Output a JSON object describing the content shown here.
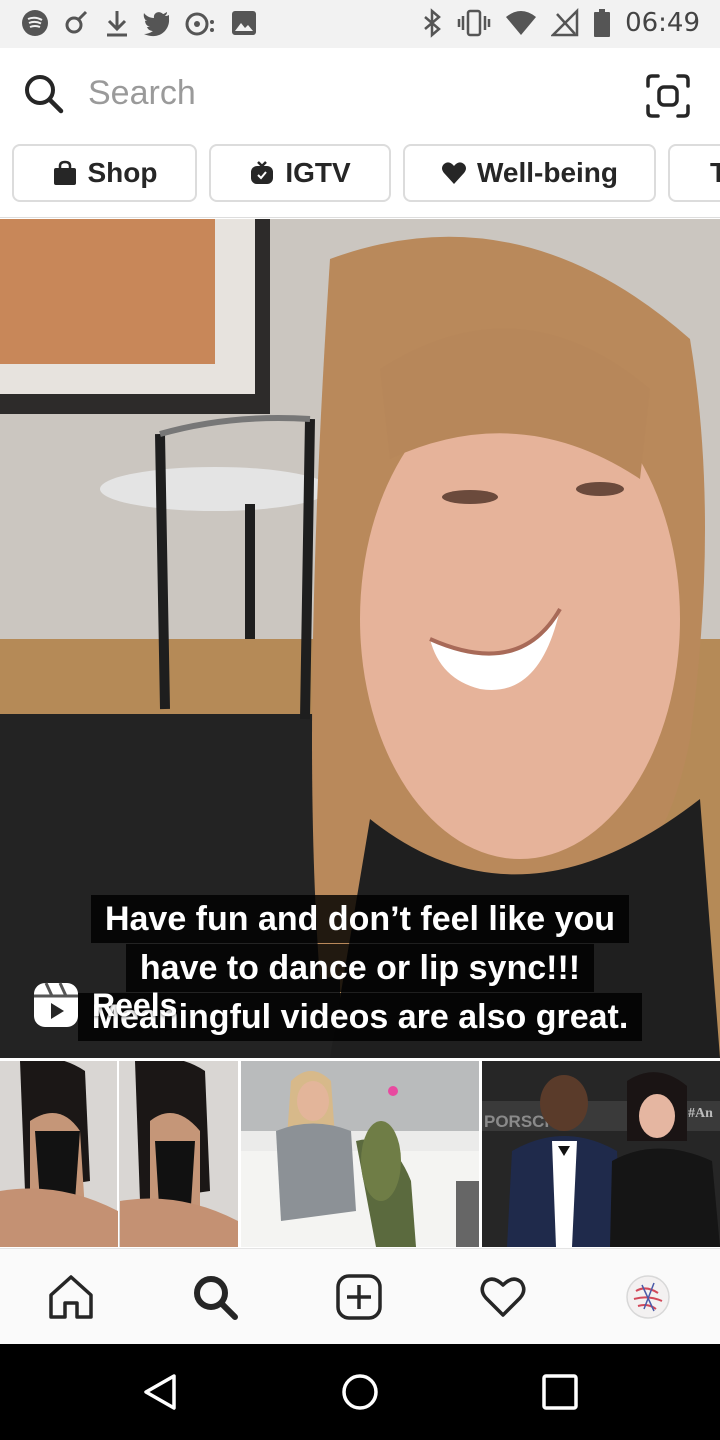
{
  "status_bar": {
    "time": "06:49",
    "left_icons": [
      "spotify-icon",
      "app-icon",
      "download-icon",
      "twitter-icon",
      "notification-icon",
      "gallery-icon"
    ],
    "right_icons": [
      "bluetooth-icon",
      "vibrate-icon",
      "wifi-icon",
      "no-signal-icon",
      "battery-icon"
    ]
  },
  "search": {
    "placeholder": "Search"
  },
  "chips": [
    {
      "label": "Shop",
      "icon": "shopping-bag-icon"
    },
    {
      "label": "IGTV",
      "icon": "igtv-icon"
    },
    {
      "label": "Well-being",
      "icon": "heart-icon"
    },
    {
      "label": "T",
      "icon": ""
    }
  ],
  "hero": {
    "caption_lines": [
      "Have fun and don’t feel like you",
      "have to dance or lip sync!!!",
      "Meaningful videos are also great."
    ],
    "badge_label": "Reels",
    "badge_icon": "reels-icon"
  },
  "thumbnails": [
    {
      "icon": "photo-thumbnail"
    },
    {
      "icon": "photo-thumbnail"
    },
    {
      "icon": "photo-thumbnail",
      "overlay_text": "PORSCHE",
      "corner_text": "#An"
    }
  ],
  "bottom_nav": [
    "home-icon",
    "search-icon",
    "add-post-icon",
    "activity-heart-icon",
    "profile-avatar"
  ],
  "system_nav": [
    "back-icon",
    "home-circle-icon",
    "recents-icon"
  ],
  "colors": {
    "text": "#262626",
    "muted": "#9a9a9a",
    "chip_border": "#dcdcdc",
    "status_bg": "#f2f2f2",
    "nav_bg": "#fafafa",
    "system_bg": "#000000"
  }
}
